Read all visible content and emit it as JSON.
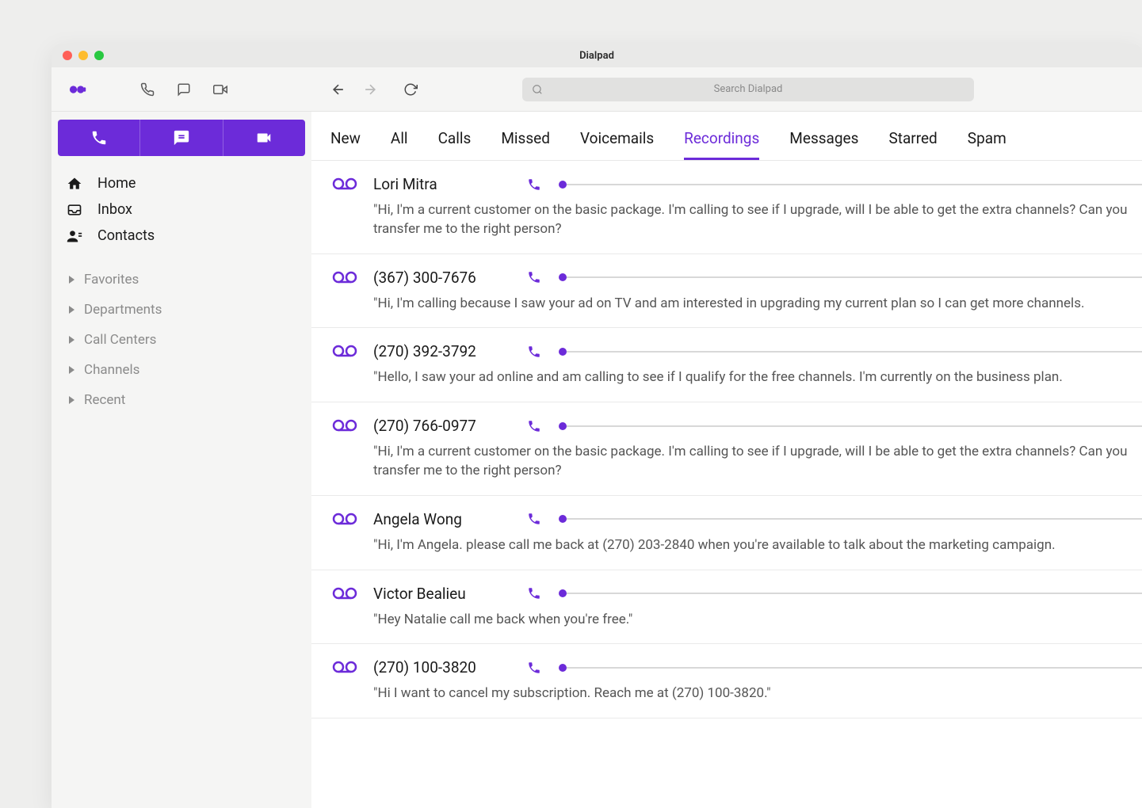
{
  "window": {
    "title": "Dialpad"
  },
  "search": {
    "placeholder": "Search Dialpad"
  },
  "sidebar": {
    "nav": [
      {
        "label": "Home",
        "icon": "home"
      },
      {
        "label": "Inbox",
        "icon": "inbox"
      },
      {
        "label": "Contacts",
        "icon": "contacts"
      }
    ],
    "sections": [
      {
        "label": "Favorites"
      },
      {
        "label": "Departments"
      },
      {
        "label": "Call Centers"
      },
      {
        "label": "Channels"
      },
      {
        "label": "Recent"
      }
    ]
  },
  "tabs": [
    {
      "label": "New",
      "active": false
    },
    {
      "label": "All",
      "active": false
    },
    {
      "label": "Calls",
      "active": false
    },
    {
      "label": "Missed",
      "active": false
    },
    {
      "label": "Voicemails",
      "active": false
    },
    {
      "label": "Recordings",
      "active": true
    },
    {
      "label": "Messages",
      "active": false
    },
    {
      "label": "Starred",
      "active": false
    },
    {
      "label": "Spam",
      "active": false
    }
  ],
  "recordings": [
    {
      "caller": "Lori Mitra",
      "transcript": "\"Hi, I'm a current customer on the basic package. I'm calling to see if I upgrade, will I be able to get the extra channels? Can you transfer me to the right person?"
    },
    {
      "caller": "(367) 300-7676",
      "transcript": "\"Hi, I'm calling because I saw your ad on TV and am interested in upgrading my current plan so I can get more channels."
    },
    {
      "caller": "(270) 392-3792",
      "transcript": "\"Hello, I saw your ad online and am calling to see if I qualify for the free channels. I'm currently on the business plan."
    },
    {
      "caller": "(270) 766-0977",
      "transcript": "\"Hi, I'm a current customer on the basic package. I'm calling to see if I upgrade, will I be able to get the extra channels? Can you transfer me to the right person?"
    },
    {
      "caller": "Angela Wong",
      "transcript": "\"Hi, I'm Angela. please call me back at (270) 203-2840 when you're available to talk about the marketing campaign."
    },
    {
      "caller": "Victor Bealieu",
      "transcript": "\"Hey Natalie call me back when you're free.\""
    },
    {
      "caller": "(270) 100-3820",
      "transcript": "\"Hi I want to cancel my subscription. Reach me at (270) 100-3820.\""
    }
  ]
}
